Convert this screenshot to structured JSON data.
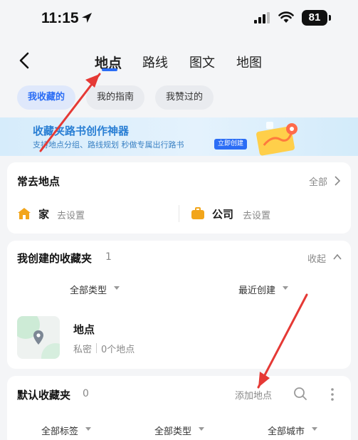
{
  "status_bar": {
    "time": "11:15",
    "battery": "81"
  },
  "nav": {
    "tabs": [
      "地点",
      "路线",
      "图文",
      "地图"
    ],
    "active_tab": 0
  },
  "filters": {
    "chips": [
      "我收藏的",
      "我的指南",
      "我赞过的"
    ],
    "active_chip": 0
  },
  "banner": {
    "title": "收藏夹路书创作神器",
    "subtitle": "支持地点分组、路线规划 秒做专属出行路书",
    "cta": "立即创建"
  },
  "frequent": {
    "title": "常去地点",
    "all_link": "全部",
    "home_label": "家",
    "home_action": "去设置",
    "company_label": "公司",
    "company_action": "去设置"
  },
  "created": {
    "title": "我创建的收藏夹",
    "count": "1",
    "collapse": "收起",
    "filter_type": "全部类型",
    "filter_sort": "最近创建",
    "item_title": "地点",
    "item_privacy": "私密",
    "item_count": "0个地点"
  },
  "default_folder": {
    "title": "默认收藏夹",
    "count": "0",
    "add_place": "添加地点",
    "filter_tag": "全部标签",
    "filter_type": "全部类型",
    "filter_city": "全部城市"
  },
  "colors": {
    "accent": "#2b6df5",
    "background": "#f4f5f7",
    "annotation_arrow": "#e53935",
    "home_icon": "#f2a51a",
    "company_icon": "#f2a51a"
  }
}
